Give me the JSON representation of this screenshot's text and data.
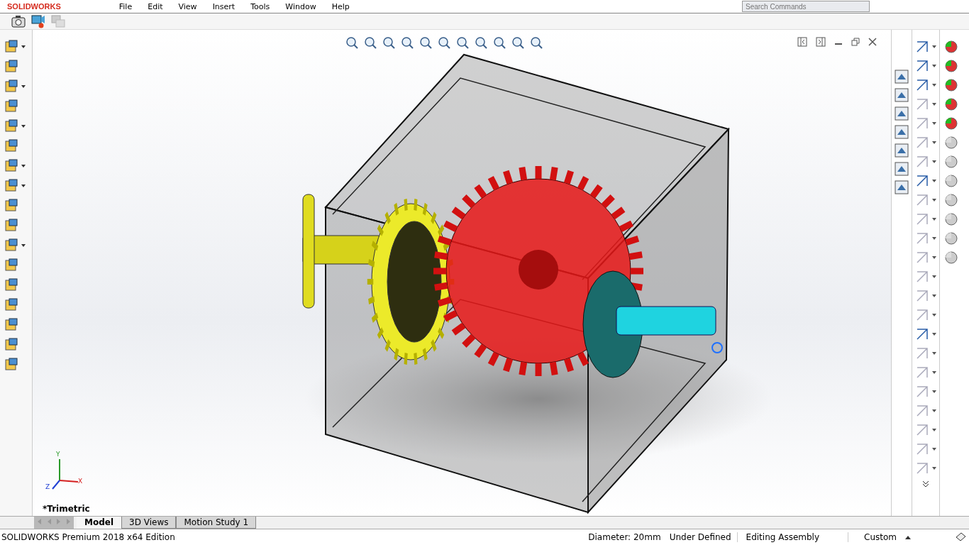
{
  "title_bar": {
    "logo": "SOLIDWORKS",
    "menu": [
      "File",
      "Edit",
      "View",
      "Insert",
      "Tools",
      "Window",
      "Help"
    ],
    "search": {
      "placeholder": "Search Commands"
    }
  },
  "viewport": {
    "view_label": "*Trimetric",
    "triad": {
      "x": "X",
      "y": "Y",
      "z": "Z"
    }
  },
  "tabs": [
    {
      "label": "Model",
      "selected": true
    },
    {
      "label": "3D Views",
      "selected": false
    },
    {
      "label": "Motion Study 1",
      "selected": false
    }
  ],
  "status_bar": {
    "product": "SOLIDWORKS Premium 2018 x64 Edition",
    "measurement": "Diameter: 20mm",
    "definition": "Under Defined",
    "mode": "Editing Assembly",
    "units": "Custom"
  }
}
